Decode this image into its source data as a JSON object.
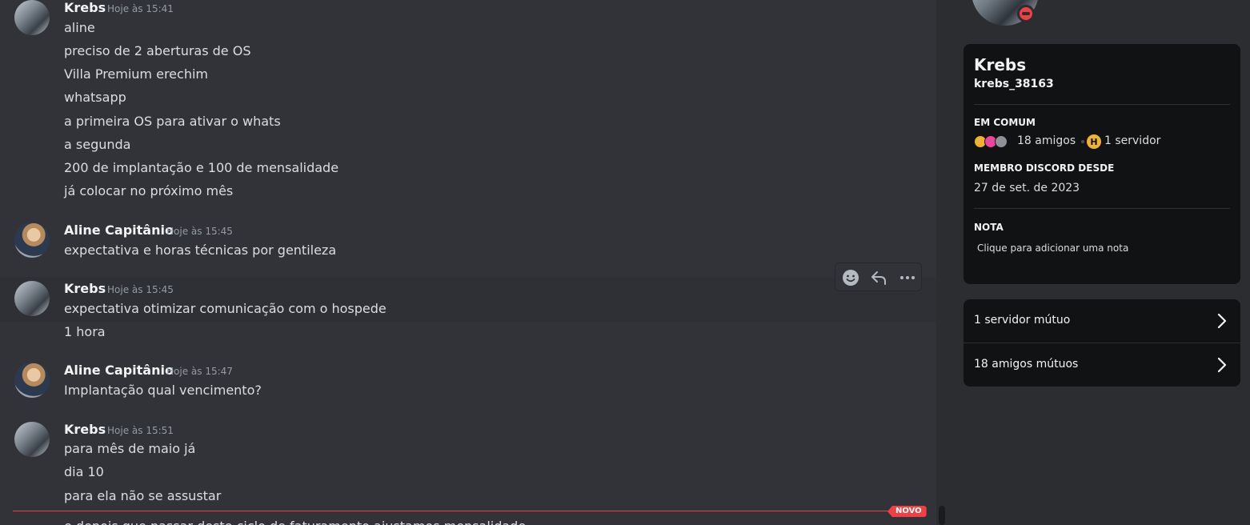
{
  "messages": [
    {
      "author": "Krebs",
      "time": "Hoje às 15:41",
      "lines": [
        "aline",
        "preciso de 2 aberturas de OS",
        "Villa Premium erechim",
        "whatsapp",
        "a primeira OS para ativar o whats",
        "a segunda",
        "200 de implantação e 100 de mensalidade",
        "já colocar no próximo mês"
      ]
    },
    {
      "author": "Aline Capitânio",
      "time": "Hoje às 15:45",
      "lines": [
        "expectativa e  horas técnicas por gentileza"
      ]
    },
    {
      "author": "Krebs",
      "time": "Hoje às 15:45",
      "lines": [
        "expectativa otimizar comunicação com o hospede",
        "1 hora"
      ]
    },
    {
      "author": "Aline Capitânio",
      "time": "Hoje às 15:47",
      "lines": [
        "Implantação qual vencimento?"
      ]
    },
    {
      "author": "Krebs",
      "time": "Hoje às 15:51",
      "lines": [
        "para mês de maio já",
        "dia 10",
        "para ela não se assustar"
      ]
    }
  ],
  "new_divider": {
    "label": "NOVO"
  },
  "partial_line": "e depois que passar deste ciclo de faturamento ajustamos mensalidade",
  "toolbar": {
    "icons": [
      "emoji-icon",
      "reply-icon",
      "more-icon"
    ]
  },
  "profile": {
    "display_name": "Krebs",
    "username": "krebs_38163",
    "status": "dnd",
    "in_common": {
      "title": "EM COMUM",
      "friends": "18 amigos",
      "servers": "1 servidor"
    },
    "member_since": {
      "title": "MEMBRO DISCORD DESDE",
      "date": "27 de set. de 2023"
    },
    "note": {
      "title": "NOTA",
      "placeholder": "Clique para adicionar uma nota"
    },
    "mutual_servers": "1 servidor mútuo",
    "mutual_friends": "18 amigos mútuos"
  },
  "colors": {
    "chat_bg": "#313338",
    "panel_bg": "#2b2d31",
    "card_bg": "#111214",
    "new_red": "#f23f43",
    "dnd_red": "#f23f43",
    "server_yellow": "#f0b232"
  }
}
